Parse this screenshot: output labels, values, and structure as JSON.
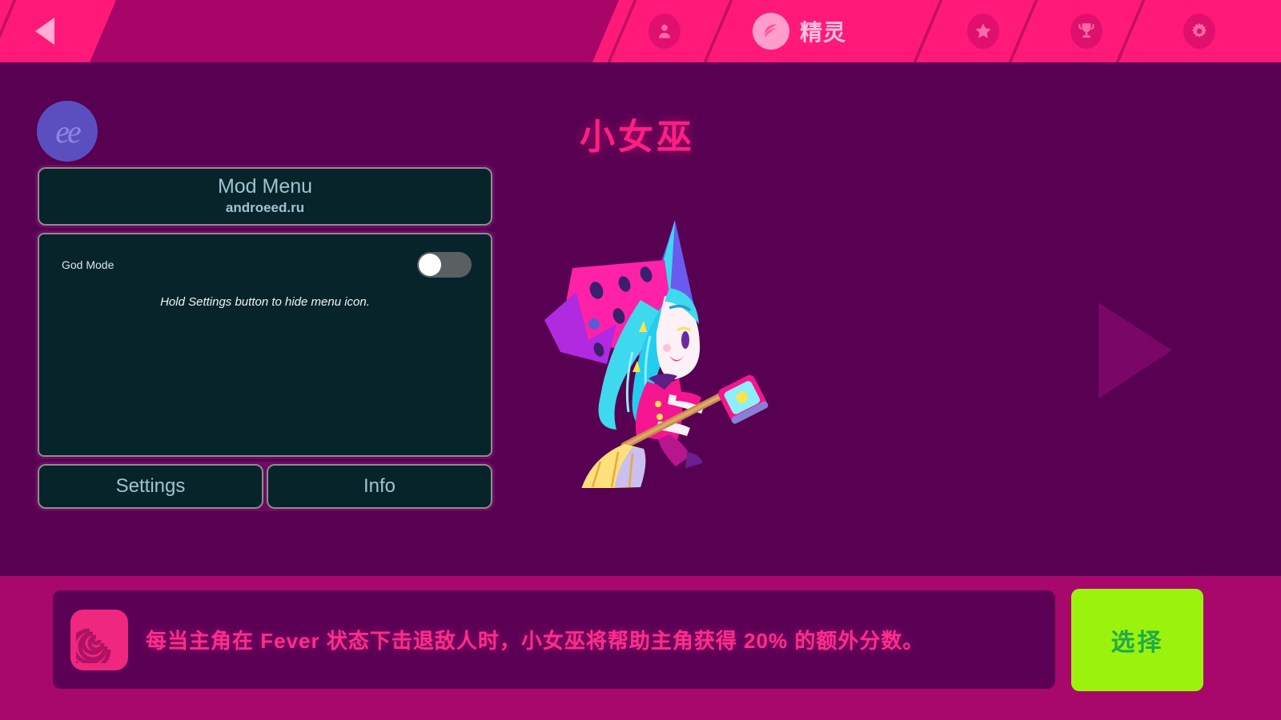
{
  "header": {
    "back_icon": "back-triangle-icon",
    "nav": [
      {
        "icon": "person-icon",
        "label": "",
        "active": false
      },
      {
        "icon": "leaf-icon",
        "label": "精灵",
        "active": true
      },
      {
        "icon": "star-icon",
        "label": "",
        "active": false
      },
      {
        "icon": "trophy-icon",
        "label": "",
        "active": false
      },
      {
        "icon": "gear-icon",
        "label": "",
        "active": false
      }
    ],
    "colors": {
      "bar": "#a80568",
      "tab": "#ff1a7a",
      "accent": "#ffaed2"
    }
  },
  "main": {
    "logo_text": "ee",
    "character_title": "小女巫",
    "next_arrow_icon": "next-triangle-icon",
    "background_color": "#580052"
  },
  "mod_menu": {
    "title": "Mod Menu",
    "subtitle": "androeed.ru",
    "toggle_label": "God Mode",
    "toggle_state": "off",
    "hint": "Hold Settings button to hide menu icon.",
    "settings_label": "Settings",
    "info_label": "Info",
    "colors": {
      "panel": "#07242a",
      "border": "#8d8d8d",
      "text": "#9ec4d2"
    }
  },
  "bottom": {
    "badge_icon": "spiral-icon",
    "description": "每当主角在 Fever 状态下击退敌人时，小女巫将帮助主角获得 20% 的额外分数。",
    "select_label": "选择",
    "colors": {
      "bar": "#a8076b",
      "desc_box": "#5b0055",
      "select": "#9bf20c",
      "select_text": "#1faa4a"
    }
  }
}
